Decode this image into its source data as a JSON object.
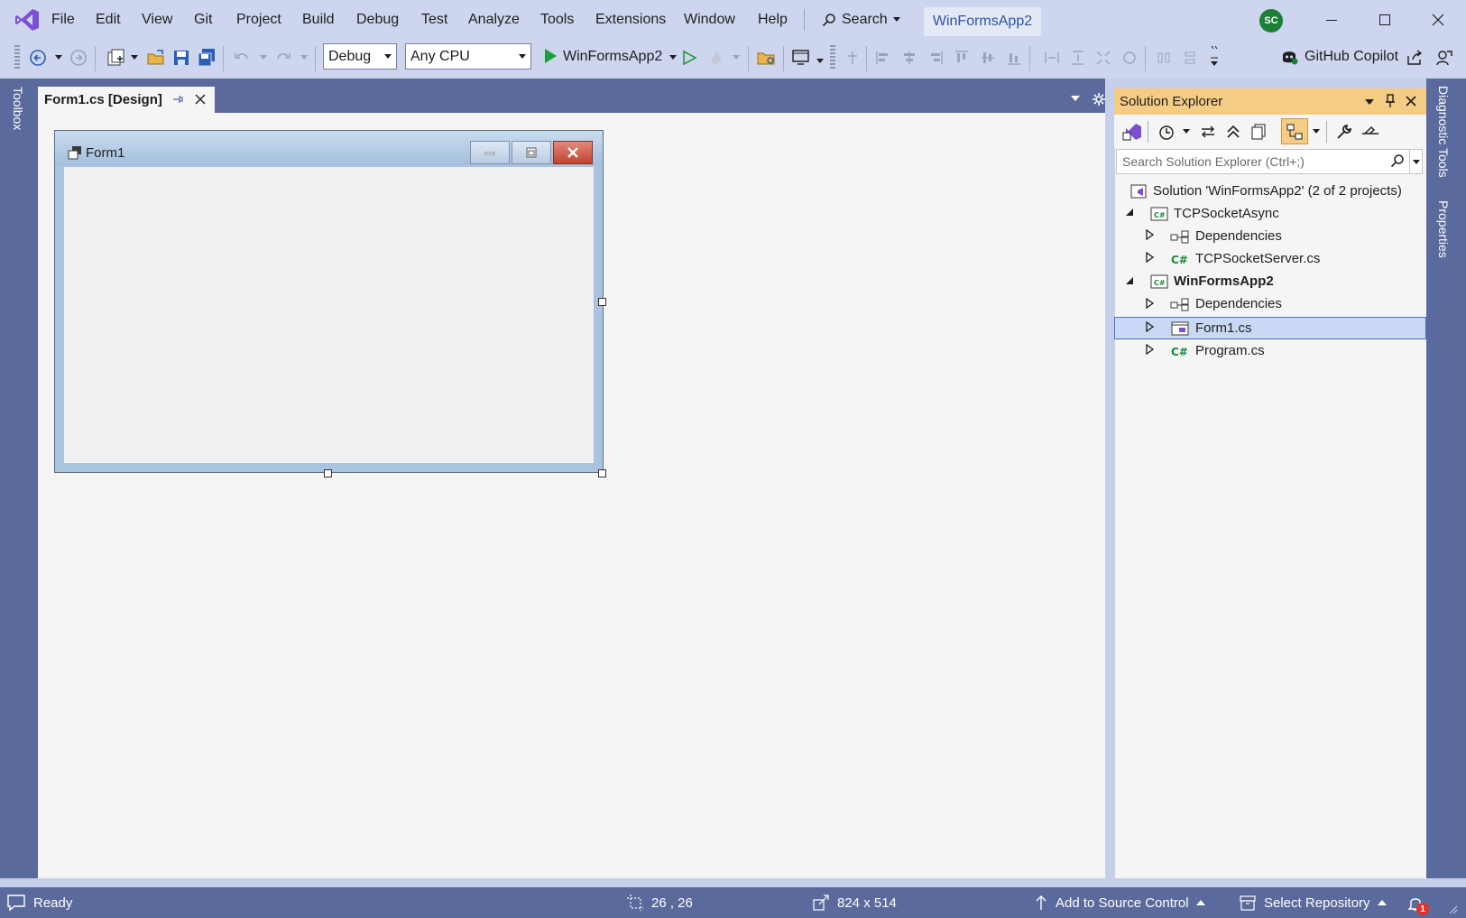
{
  "app": {
    "menu": [
      "File",
      "Edit",
      "View",
      "Git",
      "Project",
      "Build",
      "Debug",
      "Test",
      "Analyze",
      "Tools",
      "Extensions",
      "Window",
      "Help"
    ],
    "search_label": "Search",
    "solution_badge": "WinFormsApp2",
    "avatar_initials": "SC"
  },
  "toolbar": {
    "config_value": "Debug",
    "platform_value": "Any CPU",
    "run_target": "WinFormsApp2",
    "copilot_label": "GitHub Copilot"
  },
  "left_strip": {
    "toolbox_label": "Toolbox"
  },
  "document": {
    "tab_label": "Form1.cs [Design]",
    "form_title": "Form1"
  },
  "solution_explorer": {
    "title": "Solution Explorer",
    "search_placeholder": "Search Solution Explorer (Ctrl+;)",
    "tree": {
      "solution": "Solution 'WinFormsApp2' (2 of 2 projects)",
      "project1": "TCPSocketAsync",
      "p1_deps": "Dependencies",
      "p1_file": "TCPSocketServer.cs",
      "project2": "WinFormsApp2",
      "p2_deps": "Dependencies",
      "p2_form": "Form1.cs",
      "p2_program": "Program.cs"
    }
  },
  "right_strip": {
    "diag_label": "Diagnostic Tools",
    "props_label": "Properties"
  },
  "statusbar": {
    "ready": "Ready",
    "position": "26 , 26",
    "size": "824 x 514",
    "source_control": "Add to Source Control",
    "repository": "Select Repository",
    "notification_count": "1"
  },
  "colors": {
    "accent_blue": "#5b6a9c",
    "menubar_bg": "#cdd6ee",
    "se_header": "#f5cc84",
    "selection": "#c9d9f5",
    "csharp_green": "#1a8a3a",
    "run_green": "#1f9c3f"
  }
}
